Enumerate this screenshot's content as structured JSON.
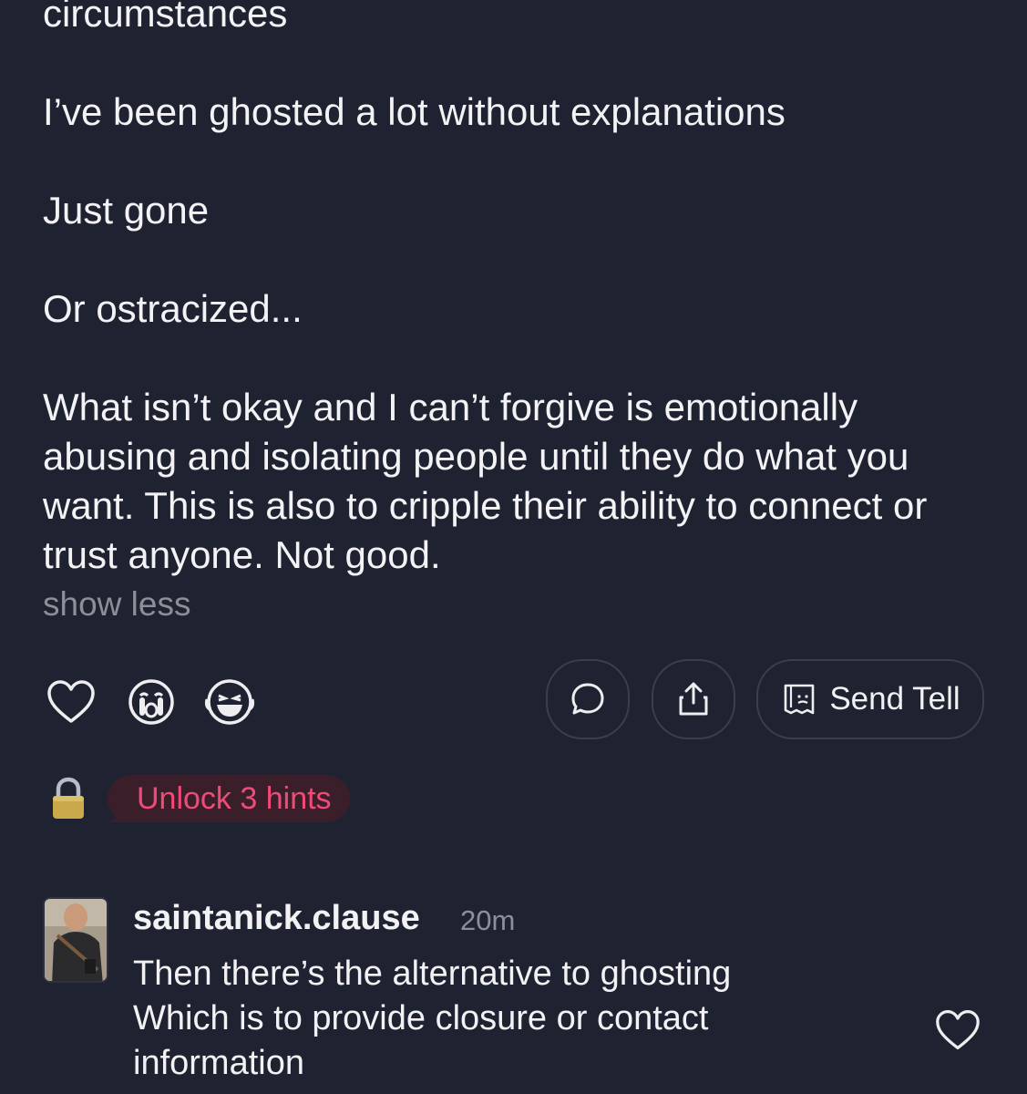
{
  "post": {
    "paragraphs": [
      "circumstances",
      "I’ve been ghosted a lot without explanations",
      "Just gone",
      "Or ostracized...",
      "What isn’t okay and I can’t forgive is emotionally abusing and isolating people until they do what you want.  This is also to cripple their ability to connect or trust anyone.  Not good."
    ],
    "show_less": "show less"
  },
  "actions": {
    "reactions": [
      "heart-icon",
      "crying-face-icon",
      "laughing-face-icon"
    ],
    "send_tell_label": "Send Tell"
  },
  "hints": {
    "label": "Unlock 3 hints"
  },
  "comment": {
    "username": "saintanick.clause",
    "timestamp": "20m",
    "lines": [
      "Then there’s the alternative to ghosting",
      "Which is to provide closure or contact",
      "information"
    ]
  },
  "colors": {
    "background": "#1f2230",
    "hint_accent": "#f04a78",
    "muted_text": "#8d8f98"
  }
}
